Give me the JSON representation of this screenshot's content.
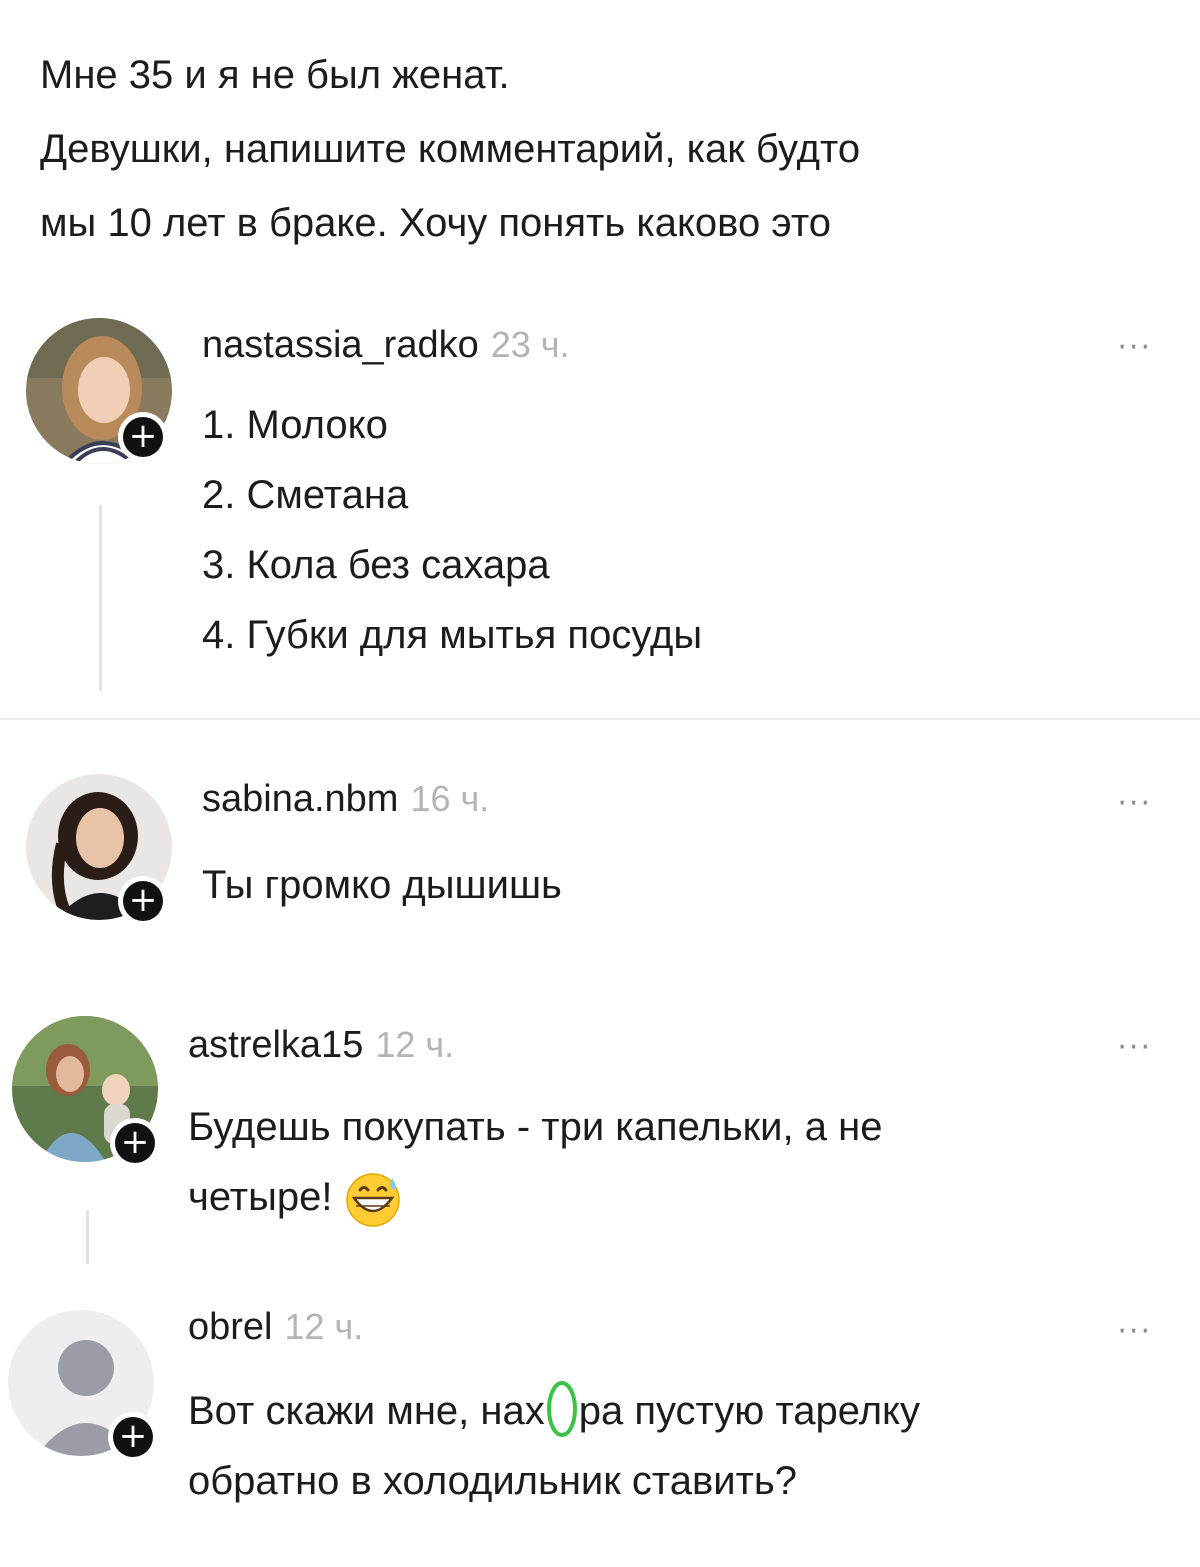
{
  "post": {
    "lines": [
      "Мне 35 и я не был женат.",
      "Девушки, напишите комментарий, как будто",
      "мы 10 лет в браке. Хочу понять каково это"
    ]
  },
  "comments": [
    {
      "username": "nastassia_radko",
      "time": "23 ч.",
      "more": "···",
      "badge": "+",
      "lines": [
        "1. Молоко",
        "2. Сметана",
        "3. Кола без сахара",
        "4. Губки для мытья посуды"
      ]
    },
    {
      "username": "sabina.nbm",
      "time": "16 ч.",
      "more": "···",
      "badge": "+",
      "lines": [
        "Ты громко дышишь"
      ]
    },
    {
      "username": "astrelka15",
      "time": "12 ч.",
      "more": "···",
      "badge": "+",
      "lines": [
        "Будешь покупать - три капельки, а не",
        "четыре!"
      ],
      "emoji": "grinning-sweat-emoji"
    },
    {
      "username": "obrel",
      "time": "12 ч.",
      "more": "···",
      "badge": "+",
      "line1_before": "Вот скажи мне, на",
      "line1_censored": "х",
      "line1_after": "ра пустую тарелку",
      "line2": "обратно в холодильник ставить?"
    }
  ],
  "colors": {
    "text": "#1c1c1c",
    "muted": "#b4b4b4",
    "badge": "#111111",
    "censor_mark": "#3cc24a"
  }
}
